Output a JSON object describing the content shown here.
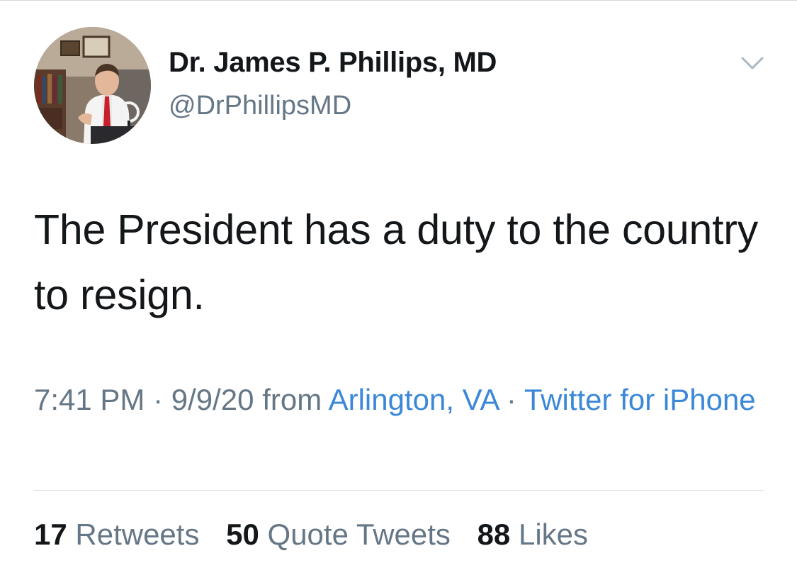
{
  "author": {
    "display_name": "Dr. James P. Phillips, MD",
    "handle": "@DrPhillipsMD",
    "avatar_icon": "profile-photo"
  },
  "menu": {
    "icon": "chevron-down-icon"
  },
  "tweet": {
    "text": "The President has a duty to the country to resign."
  },
  "meta": {
    "time": "7:41 PM",
    "separator": " · ",
    "date": "9/9/20",
    "from_label": " from ",
    "location": "Arlington, VA",
    "source": "Twitter for iPhone"
  },
  "stats": {
    "retweets_count": "17",
    "retweets_label": " Retweets",
    "quotes_count": "50",
    "quotes_label": " Quote Tweets",
    "likes_count": "88",
    "likes_label": " Likes"
  },
  "colors": {
    "text": "#14171a",
    "secondary": "#657786",
    "link": "#3b88d8",
    "divider": "#dcdcdc"
  }
}
